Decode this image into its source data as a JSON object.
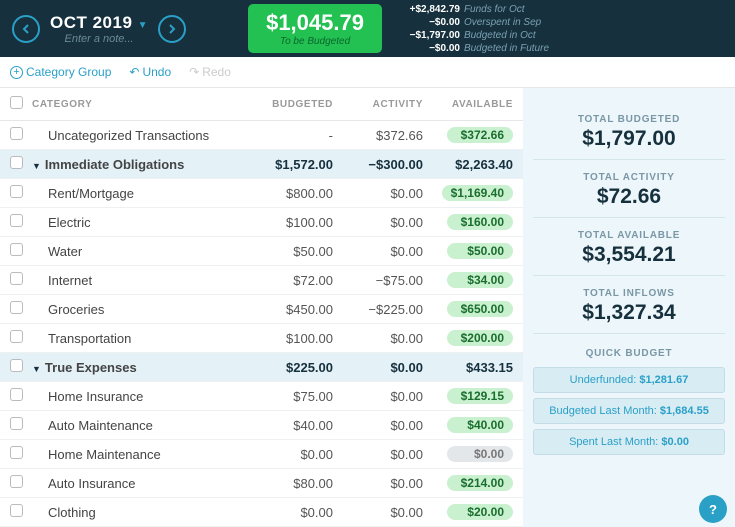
{
  "header": {
    "month": "OCT 2019",
    "note_placeholder": "Enter a note...",
    "tbb_amount": "$1,045.79",
    "tbb_label": "To be Budgeted",
    "breakdown": [
      {
        "amt": "+$2,842.79",
        "lbl": "Funds for Oct"
      },
      {
        "amt": "−$0.00",
        "lbl": "Overspent in Sep"
      },
      {
        "amt": "−$1,797.00",
        "lbl": "Budgeted in Oct"
      },
      {
        "amt": "−$0.00",
        "lbl": "Budgeted in Future"
      }
    ]
  },
  "toolbar": {
    "add_group": "Category Group",
    "undo": "Undo",
    "redo": "Redo"
  },
  "columns": {
    "category": "CATEGORY",
    "budgeted": "BUDGETED",
    "activity": "ACTIVITY",
    "available": "AVAILABLE"
  },
  "uncategorized": {
    "name": "Uncategorized Transactions",
    "budgeted": "-",
    "activity": "$372.66",
    "available": "$372.66"
  },
  "groups": [
    {
      "name": "Immediate Obligations",
      "budgeted": "$1,572.00",
      "activity": "−$300.00",
      "available": "$2,263.40",
      "cats": [
        {
          "name": "Rent/Mortgage",
          "budgeted": "$800.00",
          "activity": "$0.00",
          "available": "$1,169.40",
          "pill": "green"
        },
        {
          "name": "Electric",
          "budgeted": "$100.00",
          "activity": "$0.00",
          "available": "$160.00",
          "pill": "green"
        },
        {
          "name": "Water",
          "budgeted": "$50.00",
          "activity": "$0.00",
          "available": "$50.00",
          "pill": "green"
        },
        {
          "name": "Internet",
          "budgeted": "$72.00",
          "activity": "−$75.00",
          "available": "$34.00",
          "pill": "green"
        },
        {
          "name": "Groceries",
          "budgeted": "$450.00",
          "activity": "−$225.00",
          "available": "$650.00",
          "pill": "green"
        },
        {
          "name": "Transportation",
          "budgeted": "$100.00",
          "activity": "$0.00",
          "available": "$200.00",
          "pill": "green"
        }
      ]
    },
    {
      "name": "True Expenses",
      "budgeted": "$225.00",
      "activity": "$0.00",
      "available": "$433.15",
      "cats": [
        {
          "name": "Home Insurance",
          "budgeted": "$75.00",
          "activity": "$0.00",
          "available": "$129.15",
          "pill": "green"
        },
        {
          "name": "Auto Maintenance",
          "budgeted": "$40.00",
          "activity": "$0.00",
          "available": "$40.00",
          "pill": "green"
        },
        {
          "name": "Home Maintenance",
          "budgeted": "$0.00",
          "activity": "$0.00",
          "available": "$0.00",
          "pill": "grey"
        },
        {
          "name": "Auto Insurance",
          "budgeted": "$80.00",
          "activity": "$0.00",
          "available": "$214.00",
          "pill": "green"
        },
        {
          "name": "Clothing",
          "budgeted": "$0.00",
          "activity": "$0.00",
          "available": "$20.00",
          "pill": "green"
        }
      ]
    }
  ],
  "sidebar": {
    "total_budgeted_lbl": "TOTAL BUDGETED",
    "total_budgeted": "$1,797.00",
    "total_activity_lbl": "TOTAL ACTIVITY",
    "total_activity": "$72.66",
    "total_available_lbl": "TOTAL AVAILABLE",
    "total_available": "$3,554.21",
    "total_inflows_lbl": "TOTAL INFLOWS",
    "total_inflows": "$1,327.34",
    "quick_budget": "QUICK BUDGET",
    "qb": [
      {
        "lbl": "Underfunded: ",
        "amt": "$1,281.67"
      },
      {
        "lbl": "Budgeted Last Month: ",
        "amt": "$1,684.55"
      },
      {
        "lbl": "Spent Last Month: ",
        "amt": "$0.00"
      }
    ]
  }
}
